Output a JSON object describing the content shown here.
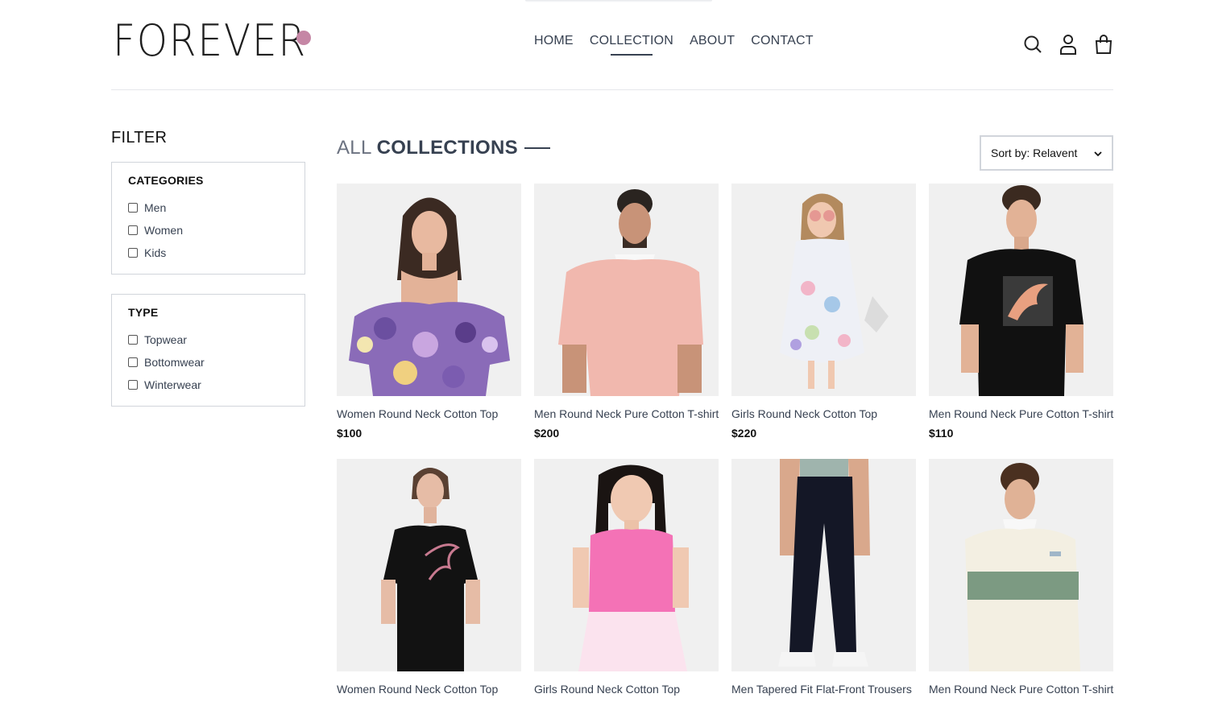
{
  "brand": {
    "name": "FOREVER",
    "dot_color": "#c586a5"
  },
  "nav": {
    "links": [
      {
        "label": "HOME",
        "active": false
      },
      {
        "label": "COLLECTION",
        "active": true
      },
      {
        "label": "ABOUT",
        "active": false
      },
      {
        "label": "CONTACT",
        "active": false
      }
    ],
    "icons": [
      "search-icon",
      "profile-icon",
      "cart-icon"
    ]
  },
  "filters": {
    "title": "FILTER",
    "categories": {
      "heading": "CATEGORIES",
      "options": [
        "Men",
        "Women",
        "Kids"
      ]
    },
    "type": {
      "heading": "TYPE",
      "options": [
        "Topwear",
        "Bottomwear",
        "Winterwear"
      ]
    }
  },
  "collection": {
    "title_part1": "ALL",
    "title_part2": "COLLECTIONS",
    "sort_label": "Sort by: Relavent"
  },
  "products": [
    {
      "name": "Women Round Neck Cotton Top",
      "price": "$100"
    },
    {
      "name": "Men Round Neck Pure Cotton T-shirt",
      "price": "$200"
    },
    {
      "name": "Girls Round Neck Cotton Top",
      "price": "$220"
    },
    {
      "name": "Men Round Neck Pure Cotton T-shirt",
      "price": "$110"
    },
    {
      "name": "Women Round Neck Cotton Top",
      "price": ""
    },
    {
      "name": "Girls Round Neck Cotton Top",
      "price": ""
    },
    {
      "name": "Men Tapered Fit Flat-Front Trousers",
      "price": ""
    },
    {
      "name": "Men Round Neck Pure Cotton T-shirt",
      "price": ""
    }
  ]
}
